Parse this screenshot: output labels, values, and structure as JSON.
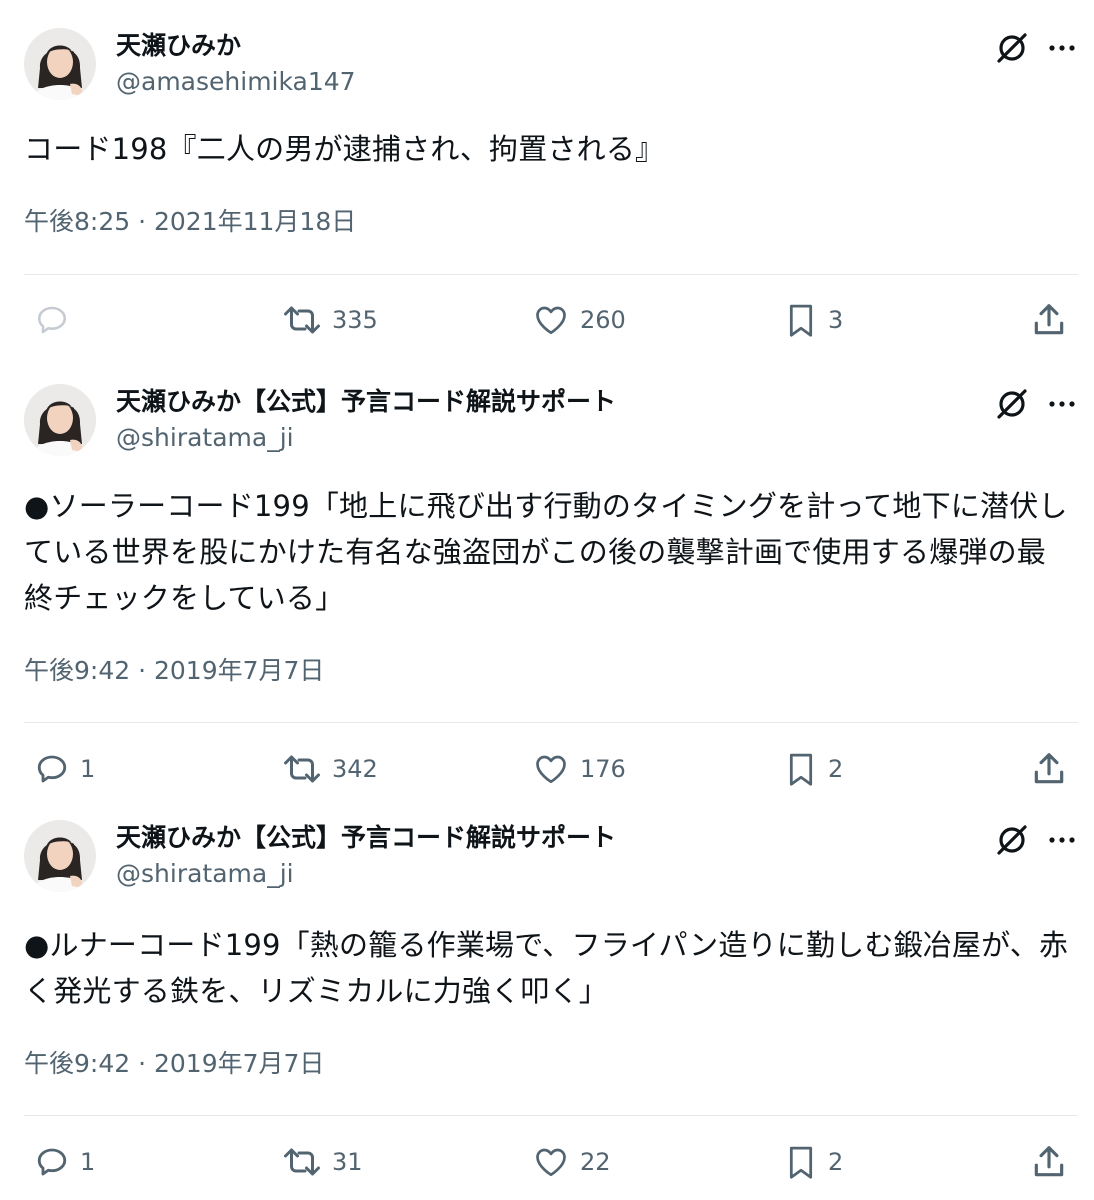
{
  "tweets": [
    {
      "display_name": "天瀬ひみか",
      "handle": "@amasehimika147",
      "text": "コード198『二人の男が逮捕され、拘置される』",
      "timestamp": "午後8:25 · 2021年11月18日",
      "replies": "",
      "retweets": "335",
      "likes": "260",
      "bookmarks": "3"
    },
    {
      "display_name": "天瀬ひみか【公式】予言コード解説サポート",
      "handle": "@shiratama_ji",
      "text": "●ソーラーコード199「地上に飛び出す行動のタイミングを計って地下に潜伏している世界を股にかけた有名な強盗団がこの後の襲撃計画で使用する爆弾の最終チェックをしている」",
      "timestamp": "午後9:42 · 2019年7月7日",
      "replies": "1",
      "retweets": "342",
      "likes": "176",
      "bookmarks": "2"
    },
    {
      "display_name": "天瀬ひみか【公式】予言コード解説サポート",
      "handle": "@shiratama_ji",
      "text": "●ルナーコード199「熱の籠る作業場で、フライパン造りに勤しむ鍛冶屋が、赤く発光する鉄を、リズミカルに力強く叩く」",
      "timestamp": "午後9:42 · 2019年7月7日",
      "replies": "1",
      "retweets": "31",
      "likes": "22",
      "bookmarks": "2"
    }
  ],
  "icons": {
    "grok": "grok-icon",
    "more": "more-icon",
    "reply": "reply-icon",
    "retweet": "retweet-icon",
    "like": "heart-icon",
    "bookmark": "bookmark-icon",
    "share": "share-icon"
  },
  "colors": {
    "text": "#0f1419",
    "secondary": "#536471",
    "divider": "#e6e9eb"
  }
}
